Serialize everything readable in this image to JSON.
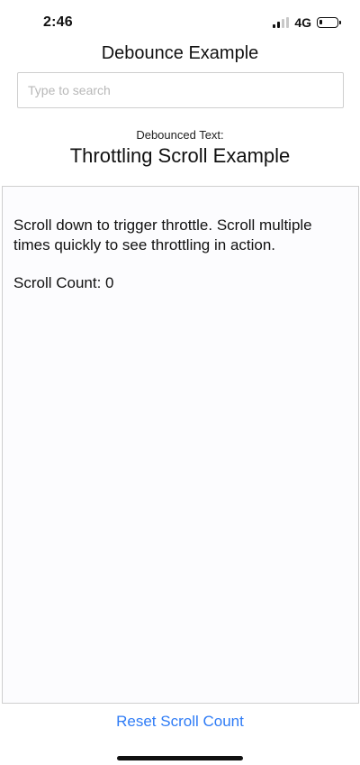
{
  "status_bar": {
    "time": "2:46",
    "network": "4G",
    "signal_icon": "signal-strength-icon",
    "battery_icon": "battery-icon",
    "battery_level": 0.2
  },
  "app": {
    "title": "Debounce Example"
  },
  "search": {
    "value": "",
    "placeholder": "Type to search"
  },
  "debounced": {
    "label": "Debounced Text:"
  },
  "throttle": {
    "title": "Throttling Scroll Example",
    "instructions": "Scroll down to trigger throttle. Scroll multiple times quickly to see throttling in action.",
    "scroll_count_text": "Scroll Count: 0"
  },
  "actions": {
    "reset_label": "Reset Scroll Count"
  },
  "colors": {
    "accent": "#2f7cf6"
  }
}
